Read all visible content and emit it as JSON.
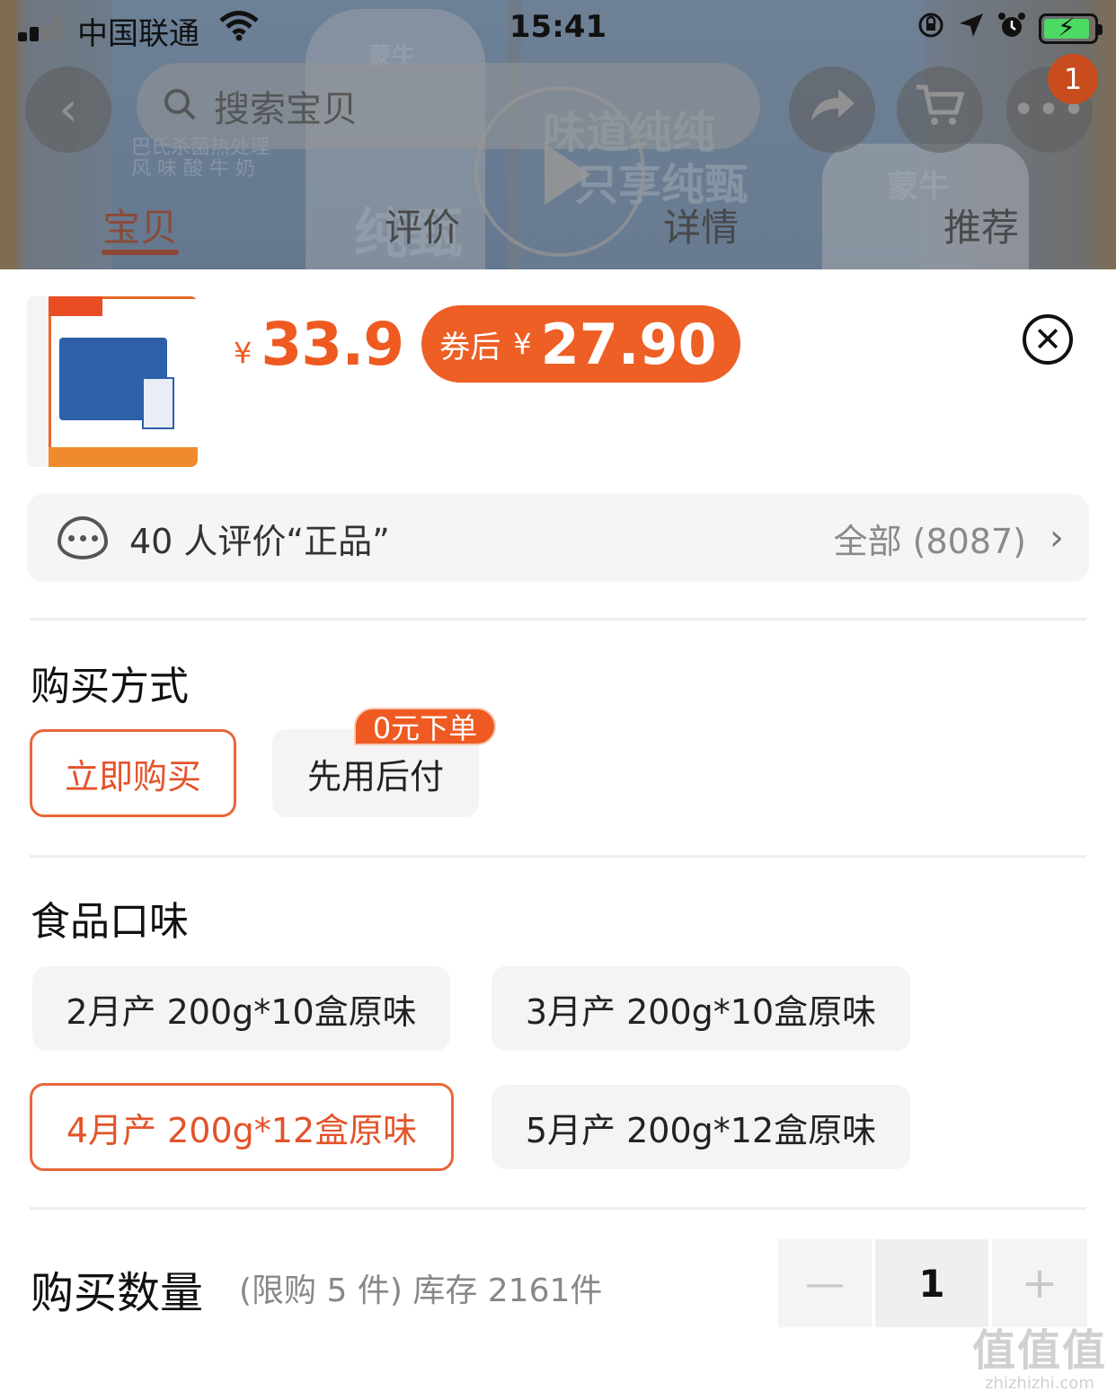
{
  "status_bar": {
    "carrier": "中国联通",
    "time": "15:41"
  },
  "background_page": {
    "search_placeholder": "搜索宝贝",
    "cart_badge": "1",
    "tabs": [
      "宝贝",
      "评价",
      "详情",
      "推荐"
    ],
    "active_tab": "宝贝",
    "product_brand": "蒙牛",
    "slogan_line1": "味道纯纯",
    "slogan_line2": "只享纯甄",
    "product_desc_line1": "巴氏杀菌热处理",
    "product_desc_line2": "风 味 酸 牛 奶",
    "product_name": "纯甄"
  },
  "sheet": {
    "price_currency": "¥",
    "price": "33.9",
    "coupon_label": "券后",
    "coupon_currency": "¥",
    "coupon_price": "27.90",
    "review_summary": "40 人评价“正品”",
    "review_all": "全部 (8087)",
    "purchase_method": {
      "title": "购买方式",
      "options": [
        "立即购买",
        "先用后付"
      ],
      "selected": "立即购买",
      "promo_tag": "0元下单"
    },
    "flavor": {
      "title": "食品口味",
      "options": [
        "2月产 200g*10盒原味",
        "3月产 200g*10盒原味",
        "4月产 200g*12盒原味",
        "5月产 200g*12盒原味"
      ],
      "selected": "4月产 200g*12盒原味"
    },
    "quantity": {
      "title": "购买数量",
      "note": "(限购 5 件) 库存 2161件",
      "value": "1",
      "minus": "—",
      "plus": "+"
    }
  },
  "watermark": {
    "big": "值值值",
    "small": "zhizhizhi.com"
  }
}
